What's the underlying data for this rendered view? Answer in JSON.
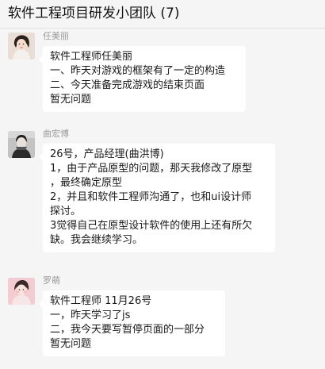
{
  "header": {
    "title": "软件工程项目研发小团队 (7)"
  },
  "messages": [
    {
      "sender": "任美丽",
      "avatar_icon": "user-avatar-icon",
      "lines": [
        "软件工程师任美丽",
        "一、昨天对游戏的框架有了一定的构造",
        "二、今天准备完成游戏的结束页面",
        "暂无问题"
      ]
    },
    {
      "sender": "曲宏博",
      "avatar_icon": "user-avatar-icon",
      "lines": [
        "26号，产品经理(曲洪博)",
        "1，由于产品原型的问题，那天我修改了原型",
        "，最终确定原型",
        "2，并且和软件工程师沟通了，也和ui设计师",
        "探讨。",
        "3觉得自己在原型设计软件的使用上还有所欠",
        "缺。我会继续学习。"
      ]
    },
    {
      "sender": "罗萌",
      "avatar_icon": "user-avatar-icon",
      "lines": [
        "软件工程师 11月26号",
        "一，昨天学习了js",
        "二，我今天要写暂停页面的一部分",
        "暂无问题"
      ]
    }
  ],
  "colors": {
    "background": "#f5f5f5",
    "bubble": "#ffffff",
    "sender_text": "#9b9b9b",
    "message_text": "#191919"
  }
}
